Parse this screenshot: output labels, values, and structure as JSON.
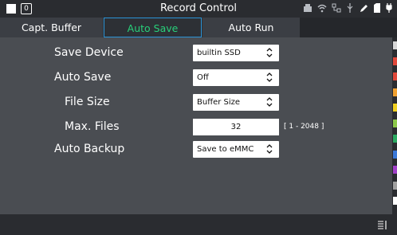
{
  "titlebar": {
    "badge": "0",
    "title": "Record Control",
    "icons": [
      "usb-storage-icon",
      "wifi-icon",
      "network-icon",
      "usb-icon",
      "pen-icon",
      "sd-card-icon",
      "power-icon"
    ]
  },
  "tabs": [
    {
      "label": "Capt. Buffer",
      "active": false
    },
    {
      "label": "Auto Save",
      "active": true
    },
    {
      "label": "Auto Run",
      "active": false
    }
  ],
  "settings": {
    "save_device": {
      "label": "Save Device",
      "value": "builtin SSD"
    },
    "auto_save": {
      "label": "Auto Save",
      "value": "Off"
    },
    "file_size": {
      "label": "File Size",
      "value": "Buffer Size"
    },
    "max_files": {
      "label": "Max. Files",
      "value": "32",
      "range": "[ 1 - 2048 ]"
    },
    "auto_backup": {
      "label": "Auto Backup",
      "value": "Save to eMMC"
    }
  },
  "colors": {
    "active_tab_text": "#28d07a",
    "active_tab_border": "#2b93d6",
    "channel_colors": [
      "#d8d8d8",
      "#e0483a",
      "#e0483a",
      "#f0a030",
      "#f0d020",
      "#8cc84a",
      "#2aa860",
      "#3a78d8",
      "#a040c8",
      "#a0a0a0",
      "#ffffff"
    ]
  }
}
